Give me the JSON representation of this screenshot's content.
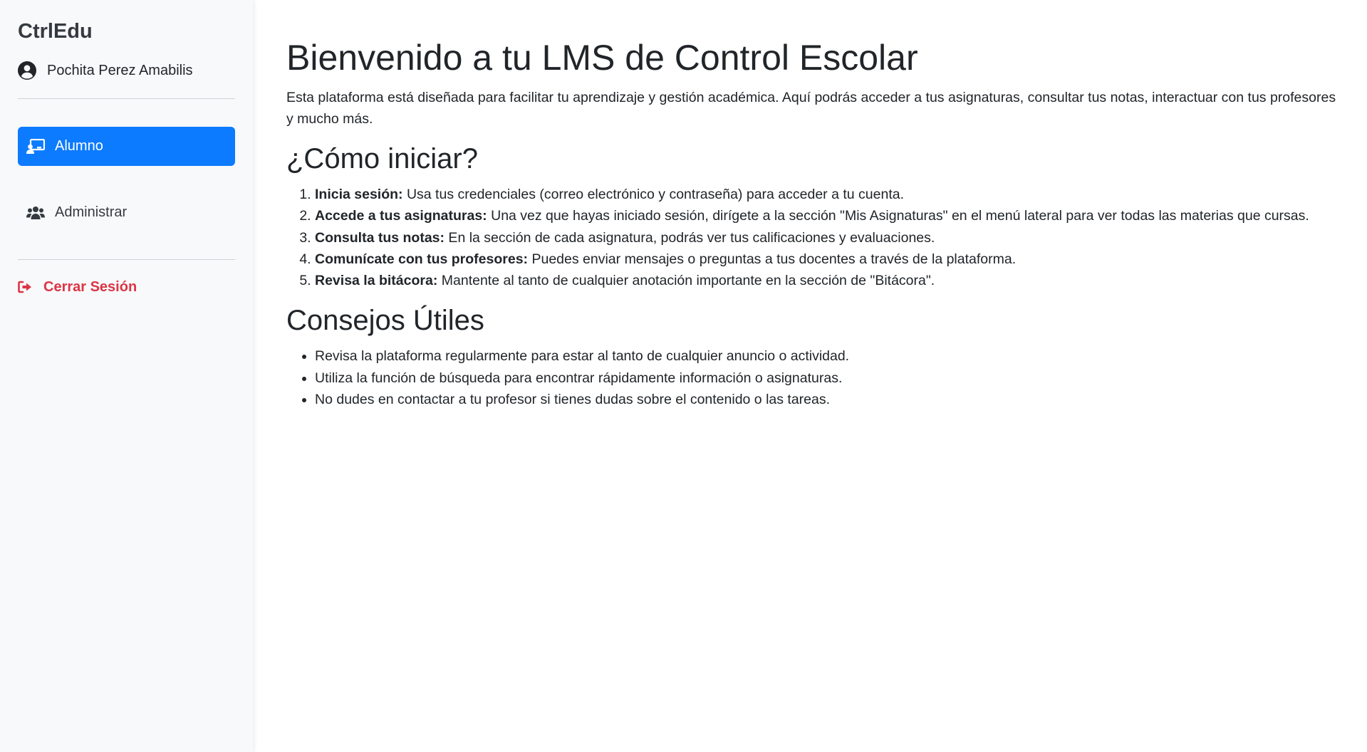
{
  "sidebar": {
    "brand": "CtrlEdu",
    "user_name": "Pochita Perez Amabilis",
    "nav": [
      {
        "label": "Alumno",
        "icon": "chalkboard-teacher-icon",
        "active": true
      },
      {
        "label": "Administrar",
        "icon": "users-icon",
        "active": false
      }
    ],
    "logout_label": "Cerrar Sesión"
  },
  "main": {
    "title": "Bienvenido a tu LMS de Control Escolar",
    "intro": "Esta plataforma está diseñada para facilitar tu aprendizaje y gestión académica. Aquí podrás acceder a tus asignaturas, consultar tus notas, interactuar con tus profesores y mucho más.",
    "how_to_title": "¿Cómo iniciar?",
    "steps": [
      {
        "bold": "Inicia sesión:",
        "text": " Usa tus credenciales (correo electrónico y contraseña) para acceder a tu cuenta."
      },
      {
        "bold": "Accede a tus asignaturas:",
        "text": " Una vez que hayas iniciado sesión, dirígete a la sección \"Mis Asignaturas\" en el menú lateral para ver todas las materias que cursas."
      },
      {
        "bold": "Consulta tus notas:",
        "text": " En la sección de cada asignatura, podrás ver tus calificaciones y evaluaciones."
      },
      {
        "bold": "Comunícate con tus profesores:",
        "text": " Puedes enviar mensajes o preguntas a tus docentes a través de la plataforma."
      },
      {
        "bold": "Revisa la bitácora:",
        "text": " Mantente al tanto de cualquier anotación importante en la sección de \"Bitácora\"."
      }
    ],
    "tips_title": "Consejos Útiles",
    "tips": [
      "Revisa la plataforma regularmente para estar al tanto de cualquier anuncio o actividad.",
      "Utiliza la función de búsqueda para encontrar rápidamente información o asignaturas.",
      "No dudes en contactar a tu profesor si tienes dudas sobre el contenido o las tareas."
    ]
  },
  "colors": {
    "accent": "#0d7bff",
    "danger": "#dc3545",
    "sidebar_bg": "#f8f9fa"
  }
}
